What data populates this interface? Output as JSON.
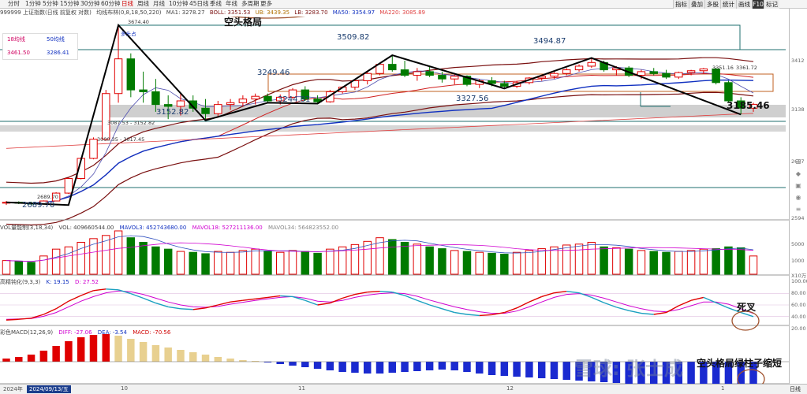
{
  "toolbar": {
    "periods": [
      "分时",
      "1分钟",
      "5分钟",
      "15分钟",
      "30分钟",
      "60分钟",
      "日线",
      "周线",
      "月线",
      "10分钟",
      "45日线",
      "季线",
      "年线",
      "多周期",
      "更多"
    ],
    "active_period": "日线",
    "right_tools": [
      "指标",
      "叠加",
      "多股",
      "统计",
      "画线",
      "F10",
      "标记"
    ]
  },
  "legend": {
    "code": "999999 上证指数(日线 前复权 对数)",
    "ma_label": "均线布林(0,8,18,50,220)",
    "ma1": "MA1: 3278.27",
    "boll": "BOLL: 3351.53",
    "ub": "UB: 3439.35",
    "lb": "LB: 3283.70",
    "ma50": "MA50: 3354.97",
    "ma220": "MA220: 3085.89"
  },
  "selector": {
    "a_label": "18均线",
    "b_label": "50均线",
    "a_value": "3461.50",
    "b_value": "3286.41"
  },
  "annotations": {
    "bear_title": "空头格局",
    "death_cross": "死叉",
    "macd_note": "空头格局绿柱子缩短",
    "watermark": "雪球: 张士成"
  },
  "price_labels": {
    "low": "2689.70",
    "low_small": "2689.70",
    "high_small": "3674.40",
    "p3152": "3152.82",
    "p3249": "3249.46",
    "p3244": "3244.81",
    "p3509": "3509.82",
    "p3327": "3327.56",
    "p3494": "3494.87",
    "p3185": "3185.46",
    "p3361": "3361.72",
    "p3361b": "3351.16",
    "range1": "3087.53 - 3152.82",
    "range2": "3000.35 - 3017.45",
    "tag": "多头占"
  },
  "right_axis": {
    "ticks": [
      "3412",
      "3138",
      "2687",
      "2594"
    ],
    "vol_ticks": [
      "5000",
      "1000"
    ],
    "vol_unit": "X10万",
    "kdj_ticks": [
      "100.00",
      "80.00",
      "60.00",
      "40.00",
      "20.00"
    ]
  },
  "vol_header": {
    "name": "VOL量能制(3,18,34)",
    "vol": "VOL: 409660544.00",
    "mavol3": "MAVOL3: 452743680.00",
    "mavol18": "MAVOL18: 527211136.00",
    "mavol34": "MAVOL34: 564823552.00"
  },
  "kdj_header": {
    "name": "高精钝化(9,3,3)",
    "k": "K: 19.15",
    "d": "D: 27.52"
  },
  "macd_header": {
    "name": "彩色MACD(12,26,9)",
    "diff": "DIFF: -27.06",
    "dea": "DEA: -3.54",
    "macd": "MACD: -70.56"
  },
  "bottom": {
    "year": "2024年",
    "date_badge": "2024/09/13/五",
    "months": [
      "10",
      "11",
      "12",
      "1"
    ],
    "right": "日线"
  },
  "colors": {
    "up": "#e00000",
    "down": "#007a00",
    "boll": "#7a1010",
    "ma50": "#1030c0",
    "ma220": "#e04040"
  },
  "chart_data": {
    "type": "candlestick",
    "candles": [
      [
        2700,
        2712,
        2690,
        2705
      ],
      [
        2705,
        2710,
        2695,
        2700
      ],
      [
        2700,
        2708,
        2689.7,
        2695
      ],
      [
        2695,
        2715,
        2692,
        2712
      ],
      [
        2712,
        2760,
        2710,
        2755
      ],
      [
        2755,
        2840,
        2750,
        2835
      ],
      [
        2835,
        2950,
        2830,
        2945
      ],
      [
        2945,
        3060,
        2940,
        3050
      ],
      [
        3050,
        3320,
        3040,
        3300
      ],
      [
        3300,
        3674.4,
        3250,
        3490
      ],
      [
        3490,
        3520,
        3280,
        3320
      ],
      [
        3320,
        3420,
        3250,
        3310
      ],
      [
        3310,
        3380,
        3200,
        3240
      ],
      [
        3240,
        3290,
        3160,
        3230
      ],
      [
        3230,
        3300,
        3180,
        3260
      ],
      [
        3260,
        3290,
        3200,
        3220
      ],
      [
        3220,
        3270,
        3152.82,
        3190
      ],
      [
        3190,
        3260,
        3170,
        3240
      ],
      [
        3240,
        3270,
        3210,
        3250
      ],
      [
        3250,
        3290,
        3230,
        3270
      ],
      [
        3270,
        3300,
        3240,
        3285
      ],
      [
        3285,
        3300,
        3250,
        3260
      ],
      [
        3260,
        3295,
        3240,
        3280
      ],
      [
        3280,
        3330,
        3270,
        3320
      ],
      [
        3320,
        3340,
        3260,
        3270
      ],
      [
        3270,
        3290,
        3244.81,
        3255
      ],
      [
        3255,
        3320,
        3250,
        3310
      ],
      [
        3310,
        3340,
        3300,
        3335
      ],
      [
        3335,
        3380,
        3320,
        3370
      ],
      [
        3370,
        3420,
        3350,
        3410
      ],
      [
        3410,
        3470,
        3400,
        3460
      ],
      [
        3460,
        3509.82,
        3420,
        3430
      ],
      [
        3430,
        3480,
        3390,
        3400
      ],
      [
        3400,
        3440,
        3370,
        3420
      ],
      [
        3420,
        3450,
        3390,
        3400
      ],
      [
        3400,
        3420,
        3360,
        3380
      ],
      [
        3380,
        3410,
        3350,
        3395
      ],
      [
        3395,
        3400,
        3340,
        3350
      ],
      [
        3350,
        3380,
        3330,
        3370
      ],
      [
        3370,
        3390,
        3340,
        3355
      ],
      [
        3355,
        3370,
        3327.56,
        3340
      ],
      [
        3340,
        3370,
        3330,
        3360
      ],
      [
        3360,
        3390,
        3350,
        3385
      ],
      [
        3385,
        3400,
        3370,
        3395
      ],
      [
        3395,
        3420,
        3380,
        3410
      ],
      [
        3410,
        3440,
        3400,
        3430
      ],
      [
        3430,
        3460,
        3420,
        3450
      ],
      [
        3450,
        3494.87,
        3440,
        3470
      ],
      [
        3470,
        3480,
        3420,
        3430
      ],
      [
        3430,
        3450,
        3400,
        3440
      ],
      [
        3440,
        3450,
        3390,
        3400
      ],
      [
        3400,
        3430,
        3380,
        3420
      ],
      [
        3420,
        3440,
        3400,
        3410
      ],
      [
        3410,
        3430,
        3380,
        3390
      ],
      [
        3390,
        3420,
        3380,
        3415
      ],
      [
        3415,
        3430,
        3400,
        3425
      ],
      [
        3425,
        3440,
        3410,
        3435
      ],
      [
        3435,
        3440,
        3350,
        3360
      ],
      [
        3360,
        3370,
        3250,
        3260
      ],
      [
        3260,
        3280,
        3185.46,
        3220
      ],
      [
        3220,
        3250,
        3200,
        3241
      ]
    ],
    "polyline_points": [
      [
        0,
        2705
      ],
      [
        5,
        2689.7
      ],
      [
        9,
        3674.4
      ],
      [
        16,
        3152.82
      ],
      [
        21,
        3249.46
      ],
      [
        25,
        3244.81
      ],
      [
        31,
        3509.82
      ],
      [
        40,
        3327.56
      ],
      [
        47,
        3494.87
      ],
      [
        59,
        3185.46
      ]
    ],
    "kdj": {
      "k": [
        10,
        12,
        15,
        25,
        40,
        60,
        75,
        88,
        92,
        90,
        80,
        68,
        55,
        45,
        40,
        38,
        42,
        50,
        58,
        62,
        66,
        70,
        74,
        72,
        62,
        50,
        55,
        68,
        78,
        84,
        86,
        84,
        75,
        62,
        50,
        40,
        30,
        25,
        22,
        24,
        30,
        42,
        58,
        72,
        82,
        86,
        82,
        70,
        56,
        44,
        35,
        28,
        25,
        30,
        48,
        62,
        70,
        56,
        42,
        30,
        19.15
      ],
      "d": [
        12,
        13,
        14,
        20,
        30,
        45,
        60,
        72,
        82,
        87,
        85,
        78,
        68,
        58,
        50,
        45,
        44,
        46,
        52,
        57,
        62,
        66,
        70,
        72,
        68,
        60,
        58,
        62,
        70,
        76,
        80,
        82,
        80,
        73,
        63,
        54,
        45,
        38,
        32,
        28,
        28,
        34,
        45,
        58,
        70,
        78,
        80,
        76,
        68,
        58,
        48,
        40,
        34,
        32,
        38,
        48,
        58,
        58,
        52,
        40,
        27.52
      ]
    },
    "macd_hist": [
      8,
      12,
      18,
      28,
      40,
      52,
      62,
      68,
      70,
      66,
      58,
      50,
      42,
      36,
      30,
      24,
      18,
      12,
      8,
      4,
      2,
      -2,
      -6,
      -10,
      -14,
      -18,
      -22,
      -26,
      -28,
      -30,
      -30,
      -28,
      -26,
      -24,
      -22,
      -20,
      -22,
      -26,
      -30,
      -34,
      -36,
      -38,
      -40,
      -42,
      -44,
      -46,
      -48,
      -50,
      -52,
      -54,
      -56,
      -58,
      -60,
      -62,
      -64,
      -68,
      -72,
      -76,
      -74,
      -72,
      -70.56
    ],
    "volume": [
      30,
      28,
      26,
      40,
      55,
      60,
      70,
      78,
      85,
      95,
      80,
      70,
      60,
      55,
      50,
      48,
      45,
      50,
      48,
      52,
      55,
      50,
      48,
      52,
      50,
      46,
      55,
      60,
      65,
      72,
      80,
      76,
      70,
      66,
      60,
      56,
      52,
      50,
      48,
      46,
      44,
      48,
      52,
      56,
      60,
      64,
      66,
      70,
      60,
      58,
      55,
      52,
      50,
      48,
      50,
      52,
      55,
      56,
      60,
      58,
      40
    ]
  }
}
